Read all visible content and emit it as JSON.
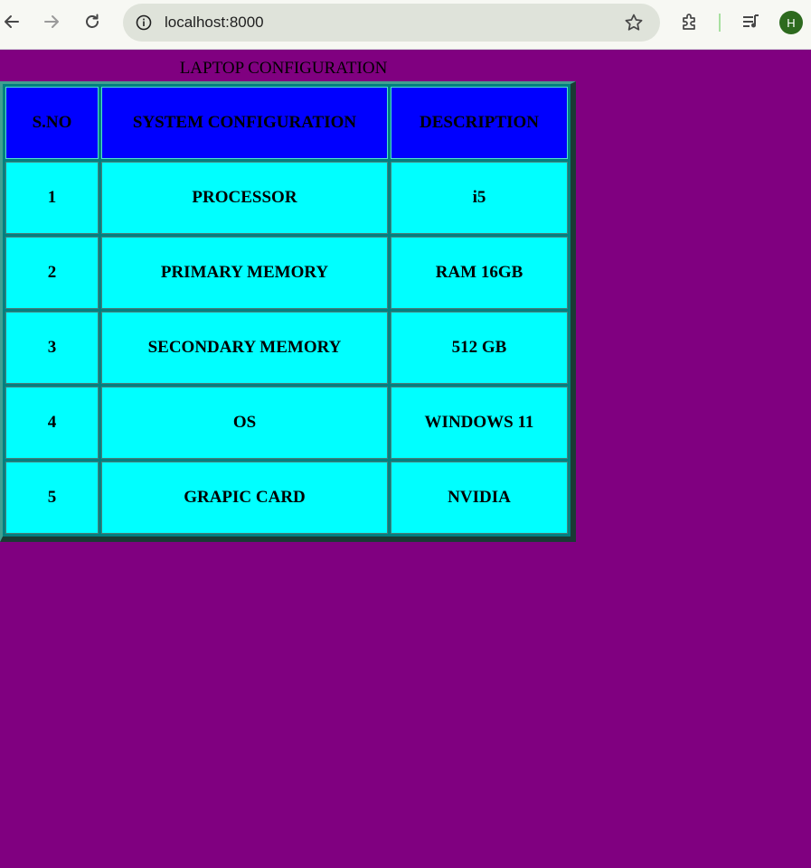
{
  "browser": {
    "url": "localhost:8000",
    "profile_initial": "H",
    "icons": {
      "back": "arrow-left-icon",
      "forward": "arrow-right-icon",
      "reload": "reload-icon",
      "site_info": "info-icon",
      "bookmark": "star-icon",
      "extensions": "puzzle-icon",
      "media": "media-queue-icon"
    }
  },
  "page": {
    "background": "#800080",
    "caption": "LAPTOP CONFIGURATION",
    "table": {
      "header_color": "#0000ff",
      "cell_color": "#00ffff",
      "headers": [
        "S.NO",
        "SYSTEM CONFIGURATION",
        "DESCRIPTION"
      ],
      "rows": [
        [
          "1",
          "PROCESSOR",
          "i5"
        ],
        [
          "2",
          "PRIMARY MEMORY",
          "RAM 16GB"
        ],
        [
          "3",
          "SECONDARY MEMORY",
          "512 GB"
        ],
        [
          "4",
          "OS",
          "WINDOWS 11"
        ],
        [
          "5",
          "GRAPIC CARD",
          "NVIDIA"
        ]
      ]
    }
  }
}
